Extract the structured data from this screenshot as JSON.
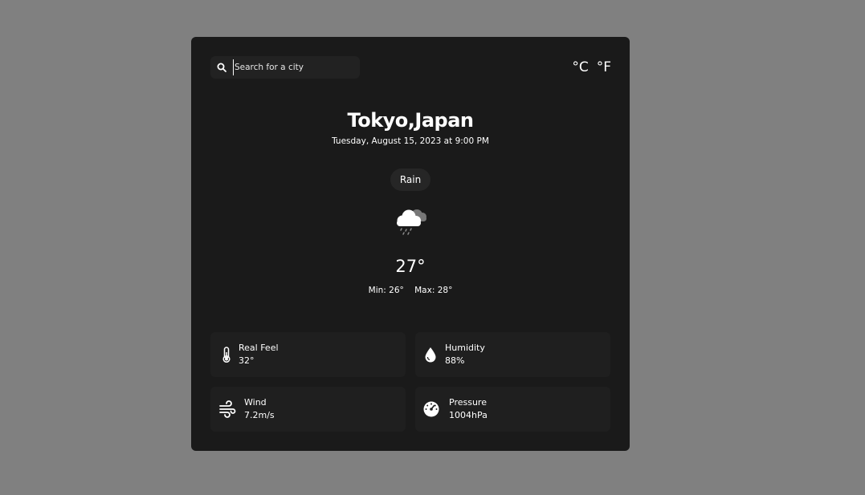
{
  "search": {
    "placeholder": "Search for a city",
    "icon": "search-icon"
  },
  "units": {
    "celsius": "°C",
    "fahrenheit": "°F"
  },
  "location": {
    "city": "Tokyo,Japan",
    "datetime": "Tuesday, August 15, 2023 at 9:00 PM"
  },
  "weather": {
    "condition": "Rain",
    "icon": "rain-cloud-icon",
    "temp": "27°",
    "min": "Min: 26°",
    "max": "Max: 28°"
  },
  "details": {
    "real_feel": {
      "label": "Real Feel",
      "value": "32°",
      "icon": "thermometer-icon"
    },
    "humidity": {
      "label": "Humidity",
      "value": "88%",
      "icon": "droplet-icon"
    },
    "wind": {
      "label": "Wind",
      "value": "7.2m/s",
      "icon": "wind-icon"
    },
    "pressure": {
      "label": "Pressure",
      "value": "1004hPa",
      "icon": "gauge-icon"
    }
  },
  "colors": {
    "background": "#808080",
    "card": "#1a1a1a",
    "tile": "#1f1f1f",
    "text": "#ffffff"
  }
}
